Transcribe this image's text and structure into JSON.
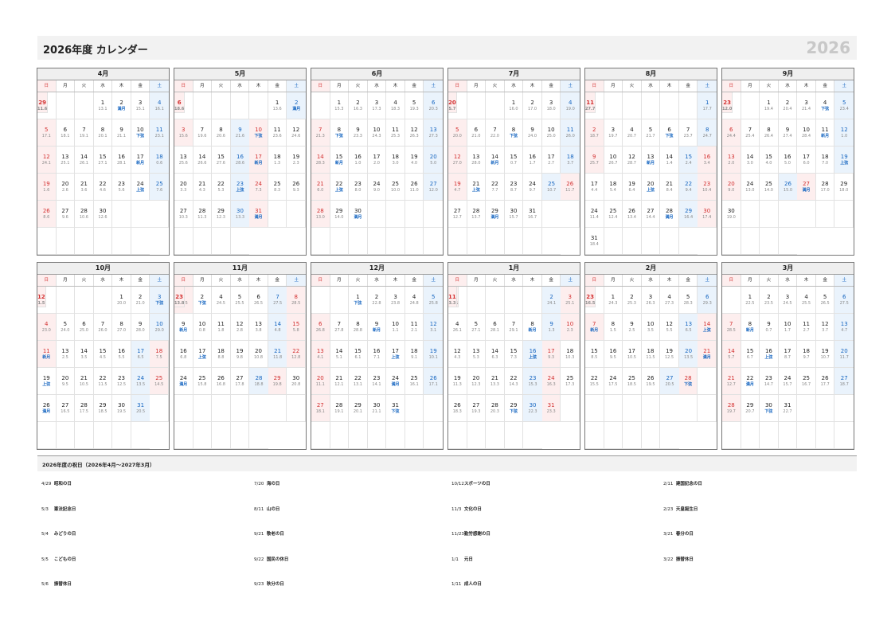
{
  "header": {
    "title": "2026年度 カレンダー",
    "year": "2026"
  },
  "weekdays": [
    "日",
    "月",
    "火",
    "水",
    "木",
    "金",
    "土"
  ],
  "months": [
    {
      "title": "4月",
      "offset": 3,
      "days": [
        {
          "a": "13.1"
        },
        {
          "a": "満月",
          "m": 1
        },
        {
          "a": "15.1"
        },
        {
          "a": "16.1"
        },
        {
          "a": "17.1"
        },
        {
          "a": "18.1"
        },
        {
          "a": "19.1"
        },
        {
          "a": "20.1"
        },
        {
          "a": "21.1"
        },
        {
          "a": "下弦",
          "m": 1
        },
        {
          "a": "23.1"
        },
        {
          "a": "24.1"
        },
        {
          "a": "25.1"
        },
        {
          "a": "26.1"
        },
        {
          "a": "27.1"
        },
        {
          "a": "28.1"
        },
        {
          "a": "新月",
          "m": 1
        },
        {
          "a": "0.6"
        },
        {
          "a": "1.6"
        },
        {
          "a": "2.6"
        },
        {
          "a": "3.6"
        },
        {
          "a": "4.6"
        },
        {
          "a": "5.6"
        },
        {
          "a": "上弦",
          "m": 1
        },
        {
          "a": "7.6"
        },
        {
          "a": "8.6"
        },
        {
          "a": "9.6"
        },
        {
          "a": "10.6"
        },
        {
          "a": "11.6",
          "h": 1
        },
        {
          "a": "12.6"
        }
      ]
    },
    {
      "title": "5月",
      "offset": 5,
      "days": [
        {
          "a": "13.6"
        },
        {
          "a": "満月",
          "m": 1
        },
        {
          "a": "15.6",
          "h": 1
        },
        {
          "a": "16.6",
          "h": 1
        },
        {
          "a": "17.6",
          "h": 1
        },
        {
          "a": "18.6",
          "h": 1
        },
        {
          "a": "19.6"
        },
        {
          "a": "20.6"
        },
        {
          "a": "21.6"
        },
        {
          "a": "下弦",
          "m": 1
        },
        {
          "a": "23.6"
        },
        {
          "a": "24.6"
        },
        {
          "a": "25.6"
        },
        {
          "a": "26.6"
        },
        {
          "a": "27.6"
        },
        {
          "a": "28.6"
        },
        {
          "a": "新月",
          "m": 1
        },
        {
          "a": "1.3"
        },
        {
          "a": "2.3"
        },
        {
          "a": "3.3"
        },
        {
          "a": "4.3"
        },
        {
          "a": "5.3"
        },
        {
          "a": "上弦",
          "m": 1
        },
        {
          "a": "7.3"
        },
        {
          "a": "8.3"
        },
        {
          "a": "9.3"
        },
        {
          "a": "10.3"
        },
        {
          "a": "11.3"
        },
        {
          "a": "12.3"
        },
        {
          "a": "13.3"
        },
        {
          "a": "満月",
          "m": 1
        }
      ]
    },
    {
      "title": "6月",
      "offset": 1,
      "days": [
        {
          "a": "15.3"
        },
        {
          "a": "16.3"
        },
        {
          "a": "17.3"
        },
        {
          "a": "18.3"
        },
        {
          "a": "19.3"
        },
        {
          "a": "20.3"
        },
        {
          "a": "21.3"
        },
        {
          "a": "下弦",
          "m": 1
        },
        {
          "a": "23.3"
        },
        {
          "a": "24.3"
        },
        {
          "a": "25.3"
        },
        {
          "a": "26.3"
        },
        {
          "a": "27.3"
        },
        {
          "a": "28.3"
        },
        {
          "a": "新月",
          "m": 1
        },
        {
          "a": "1.0"
        },
        {
          "a": "2.0"
        },
        {
          "a": "3.0"
        },
        {
          "a": "4.0"
        },
        {
          "a": "5.0"
        },
        {
          "a": "6.0"
        },
        {
          "a": "上弦",
          "m": 1
        },
        {
          "a": "8.0"
        },
        {
          "a": "9.0"
        },
        {
          "a": "10.0"
        },
        {
          "a": "11.0"
        },
        {
          "a": "12.0"
        },
        {
          "a": "13.0"
        },
        {
          "a": "14.0"
        },
        {
          "a": "満月",
          "m": 1
        }
      ]
    },
    {
      "title": "7月",
      "offset": 3,
      "days": [
        {
          "a": "16.0"
        },
        {
          "a": "17.0"
        },
        {
          "a": "18.0"
        },
        {
          "a": "19.0"
        },
        {
          "a": "20.0"
        },
        {
          "a": "21.0"
        },
        {
          "a": "22.0"
        },
        {
          "a": "下弦",
          "m": 1
        },
        {
          "a": "24.0"
        },
        {
          "a": "25.0"
        },
        {
          "a": "26.0"
        },
        {
          "a": "27.0"
        },
        {
          "a": "28.0"
        },
        {
          "a": "新月",
          "m": 1
        },
        {
          "a": "0.7"
        },
        {
          "a": "1.7"
        },
        {
          "a": "2.7"
        },
        {
          "a": "3.7"
        },
        {
          "a": "4.7"
        },
        {
          "a": "5.7",
          "h": 1
        },
        {
          "a": "上弦",
          "m": 1
        },
        {
          "a": "7.7"
        },
        {
          "a": "8.7"
        },
        {
          "a": "9.7"
        },
        {
          "a": "10.7"
        },
        {
          "a": "11.7"
        },
        {
          "a": "12.7"
        },
        {
          "a": "13.7"
        },
        {
          "a": "満月",
          "m": 1
        },
        {
          "a": "15.7"
        },
        {
          "a": "16.7"
        }
      ]
    },
    {
      "title": "8月",
      "offset": 6,
      "days": [
        {
          "a": "17.7"
        },
        {
          "a": "18.7"
        },
        {
          "a": "19.7"
        },
        {
          "a": "20.7"
        },
        {
          "a": "21.7"
        },
        {
          "a": "下弦",
          "m": 1
        },
        {
          "a": "23.7"
        },
        {
          "a": "24.7"
        },
        {
          "a": "25.7"
        },
        {
          "a": "26.7"
        },
        {
          "a": "27.7",
          "h": 1
        },
        {
          "a": "28.7"
        },
        {
          "a": "新月",
          "m": 1
        },
        {
          "a": "1.4"
        },
        {
          "a": "2.4"
        },
        {
          "a": "3.4"
        },
        {
          "a": "4.4"
        },
        {
          "a": "5.4"
        },
        {
          "a": "6.4"
        },
        {
          "a": "上弦",
          "m": 1
        },
        {
          "a": "8.4"
        },
        {
          "a": "9.4"
        },
        {
          "a": "10.4"
        },
        {
          "a": "11.4"
        },
        {
          "a": "12.4"
        },
        {
          "a": "13.4"
        },
        {
          "a": "14.4"
        },
        {
          "a": "満月",
          "m": 1
        },
        {
          "a": "16.4"
        },
        {
          "a": "17.4"
        },
        {
          "a": "18.4"
        }
      ]
    },
    {
      "title": "9月",
      "offset": 2,
      "days": [
        {
          "a": "19.4"
        },
        {
          "a": "20.4"
        },
        {
          "a": "21.4"
        },
        {
          "a": "下弦",
          "m": 1
        },
        {
          "a": "23.4"
        },
        {
          "a": "24.4"
        },
        {
          "a": "25.4"
        },
        {
          "a": "26.4"
        },
        {
          "a": "27.4"
        },
        {
          "a": "28.4"
        },
        {
          "a": "新月",
          "m": 1
        },
        {
          "a": "1.0"
        },
        {
          "a": "2.0"
        },
        {
          "a": "3.0"
        },
        {
          "a": "4.0"
        },
        {
          "a": "5.0"
        },
        {
          "a": "6.0"
        },
        {
          "a": "7.0"
        },
        {
          "a": "上弦",
          "m": 1
        },
        {
          "a": "9.0"
        },
        {
          "a": "10.0",
          "h": 1
        },
        {
          "a": "11.0",
          "h": 1
        },
        {
          "a": "12.0",
          "h": 1
        },
        {
          "a": "13.0"
        },
        {
          "a": "14.0"
        },
        {
          "a": "15.0"
        },
        {
          "a": "満月",
          "m": 1
        },
        {
          "a": "17.0"
        },
        {
          "a": "18.0"
        },
        {
          "a": "19.0"
        }
      ]
    },
    {
      "title": "10月",
      "offset": 4,
      "days": [
        {
          "a": "20.0"
        },
        {
          "a": "21.0"
        },
        {
          "a": "下弦",
          "m": 1
        },
        {
          "a": "23.0"
        },
        {
          "a": "24.0"
        },
        {
          "a": "25.0"
        },
        {
          "a": "26.0"
        },
        {
          "a": "27.0"
        },
        {
          "a": "28.0"
        },
        {
          "a": "29.0"
        },
        {
          "a": "新月",
          "m": 1
        },
        {
          "a": "1.5",
          "h": 1
        },
        {
          "a": "2.5"
        },
        {
          "a": "3.5"
        },
        {
          "a": "4.5"
        },
        {
          "a": "5.5"
        },
        {
          "a": "6.5"
        },
        {
          "a": "7.5"
        },
        {
          "a": "上弦",
          "m": 1
        },
        {
          "a": "9.5"
        },
        {
          "a": "10.5"
        },
        {
          "a": "11.5"
        },
        {
          "a": "12.5"
        },
        {
          "a": "13.5"
        },
        {
          "a": "14.5"
        },
        {
          "a": "満月",
          "m": 1
        },
        {
          "a": "16.5"
        },
        {
          "a": "17.5"
        },
        {
          "a": "18.5"
        },
        {
          "a": "19.5"
        },
        {
          "a": "20.5"
        }
      ]
    },
    {
      "title": "11月",
      "offset": 0,
      "days": [
        {
          "a": "21.5"
        },
        {
          "a": "下弦",
          "m": 1
        },
        {
          "a": "23.5",
          "h": 1
        },
        {
          "a": "24.5"
        },
        {
          "a": "25.5"
        },
        {
          "a": "26.5"
        },
        {
          "a": "27.5"
        },
        {
          "a": "28.5"
        },
        {
          "a": "新月",
          "m": 1
        },
        {
          "a": "0.8"
        },
        {
          "a": "1.8"
        },
        {
          "a": "2.8"
        },
        {
          "a": "3.8"
        },
        {
          "a": "4.8"
        },
        {
          "a": "5.8"
        },
        {
          "a": "6.8"
        },
        {
          "a": "上弦",
          "m": 1
        },
        {
          "a": "8.8"
        },
        {
          "a": "9.8"
        },
        {
          "a": "10.8"
        },
        {
          "a": "11.8"
        },
        {
          "a": "12.8"
        },
        {
          "a": "13.8",
          "h": 1
        },
        {
          "a": "満月",
          "m": 1
        },
        {
          "a": "15.8"
        },
        {
          "a": "16.8"
        },
        {
          "a": "17.8"
        },
        {
          "a": "18.8"
        },
        {
          "a": "19.8"
        },
        {
          "a": "20.8"
        }
      ]
    },
    {
      "title": "12月",
      "offset": 2,
      "days": [
        {
          "a": "下弦",
          "m": 1
        },
        {
          "a": "22.8"
        },
        {
          "a": "23.8"
        },
        {
          "a": "24.8"
        },
        {
          "a": "25.8"
        },
        {
          "a": "26.8"
        },
        {
          "a": "27.8"
        },
        {
          "a": "28.8"
        },
        {
          "a": "新月",
          "m": 1
        },
        {
          "a": "1.1"
        },
        {
          "a": "2.1"
        },
        {
          "a": "3.1"
        },
        {
          "a": "4.1"
        },
        {
          "a": "5.1"
        },
        {
          "a": "6.1"
        },
        {
          "a": "7.1"
        },
        {
          "a": "上弦",
          "m": 1
        },
        {
          "a": "9.1"
        },
        {
          "a": "10.1"
        },
        {
          "a": "11.1"
        },
        {
          "a": "12.1"
        },
        {
          "a": "13.1"
        },
        {
          "a": "14.1"
        },
        {
          "a": "満月",
          "m": 1
        },
        {
          "a": "16.1"
        },
        {
          "a": "17.1"
        },
        {
          "a": "18.1"
        },
        {
          "a": "19.1"
        },
        {
          "a": "20.1"
        },
        {
          "a": "21.1"
        },
        {
          "a": "下弦",
          "m": 1
        }
      ]
    },
    {
      "title": "1月",
      "offset": 5,
      "days": [
        {
          "a": "23.1",
          "h": 1
        },
        {
          "a": "24.1"
        },
        {
          "a": "25.1"
        },
        {
          "a": "26.1"
        },
        {
          "a": "27.1"
        },
        {
          "a": "28.1"
        },
        {
          "a": "29.1"
        },
        {
          "a": "新月",
          "m": 1
        },
        {
          "a": "1.3"
        },
        {
          "a": "2.3"
        },
        {
          "a": "3.3",
          "h": 1
        },
        {
          "a": "4.3"
        },
        {
          "a": "5.3"
        },
        {
          "a": "6.3"
        },
        {
          "a": "7.3"
        },
        {
          "a": "上弦",
          "m": 1
        },
        {
          "a": "9.3"
        },
        {
          "a": "10.3"
        },
        {
          "a": "11.3"
        },
        {
          "a": "12.3"
        },
        {
          "a": "13.3"
        },
        {
          "a": "14.3"
        },
        {
          "a": "15.3"
        },
        {
          "a": "16.3"
        },
        {
          "a": "17.3"
        },
        {
          "a": "18.3"
        },
        {
          "a": "19.3"
        },
        {
          "a": "20.3"
        },
        {
          "a": "下弦",
          "m": 1
        },
        {
          "a": "22.3"
        },
        {
          "a": "23.3"
        }
      ]
    },
    {
      "title": "2月",
      "offset": 1,
      "days": [
        {
          "a": "24.3"
        },
        {
          "a": "25.3"
        },
        {
          "a": "26.3"
        },
        {
          "a": "27.3"
        },
        {
          "a": "28.3"
        },
        {
          "a": "29.3"
        },
        {
          "a": "新月",
          "m": 1
        },
        {
          "a": "1.5"
        },
        {
          "a": "2.5"
        },
        {
          "a": "3.5"
        },
        {
          "a": "4.5",
          "h": 1
        },
        {
          "a": "5.5"
        },
        {
          "a": "6.5"
        },
        {
          "a": "上弦",
          "m": 1
        },
        {
          "a": "8.5"
        },
        {
          "a": "9.5"
        },
        {
          "a": "10.5"
        },
        {
          "a": "11.5"
        },
        {
          "a": "12.5"
        },
        {
          "a": "13.5"
        },
        {
          "a": "満月",
          "m": 1
        },
        {
          "a": "15.5"
        },
        {
          "a": "16.5",
          "h": 1
        },
        {
          "a": "17.5"
        },
        {
          "a": "18.5"
        },
        {
          "a": "19.5"
        },
        {
          "a": "20.5"
        },
        {
          "a": "下弦",
          "m": 1
        }
      ]
    },
    {
      "title": "3月",
      "offset": 1,
      "days": [
        {
          "a": "22.5"
        },
        {
          "a": "23.5"
        },
        {
          "a": "24.5"
        },
        {
          "a": "25.5"
        },
        {
          "a": "26.5"
        },
        {
          "a": "27.5"
        },
        {
          "a": "28.5"
        },
        {
          "a": "新月",
          "m": 1
        },
        {
          "a": "0.7"
        },
        {
          "a": "1.7"
        },
        {
          "a": "2.7"
        },
        {
          "a": "3.7"
        },
        {
          "a": "4.7"
        },
        {
          "a": "5.7"
        },
        {
          "a": "6.7"
        },
        {
          "a": "上弦",
          "m": 1
        },
        {
          "a": "8.7"
        },
        {
          "a": "9.7"
        },
        {
          "a": "10.7"
        },
        {
          "a": "11.7"
        },
        {
          "a": "12.7"
        },
        {
          "a": "満月",
          "m": 1
        },
        {
          "a": "14.7"
        },
        {
          "a": "15.7"
        },
        {
          "a": "16.7"
        },
        {
          "a": "17.7"
        },
        {
          "a": "18.7"
        },
        {
          "a": "19.7"
        },
        {
          "a": "20.7"
        },
        {
          "a": "下弦",
          "m": 1
        },
        {
          "a": "22.7"
        }
      ]
    }
  ],
  "holidays": {
    "title": "2026年度の祝日（2026年4月～2027年3月）",
    "columns": [
      [
        {
          "date": "4/29",
          "name": "昭和の日"
        },
        {
          "date": "5/3",
          "name": "憲法記念日"
        },
        {
          "date": "5/4",
          "name": "みどりの日"
        },
        {
          "date": "5/5",
          "name": "こどもの日"
        },
        {
          "date": "5/6",
          "name": "振替休日"
        }
      ],
      [
        {
          "date": "7/20",
          "name": "海の日"
        },
        {
          "date": "8/11",
          "name": "山の日"
        },
        {
          "date": "9/21",
          "name": "敬老の日"
        },
        {
          "date": "9/22",
          "name": "国民の休日"
        },
        {
          "date": "9/23",
          "name": "秋分の日"
        }
      ],
      [
        {
          "date": "10/12",
          "name": "スポーツの日"
        },
        {
          "date": "11/3",
          "name": "文化の日"
        },
        {
          "date": "11/23",
          "name": "勤労感謝の日"
        },
        {
          "date": "1/1",
          "name": "元日"
        },
        {
          "date": "1/11",
          "name": "成人の日"
        }
      ],
      [
        {
          "date": "2/11",
          "name": "建国記念の日"
        },
        {
          "date": "2/23",
          "name": "天皇誕生日"
        },
        {
          "date": "3/21",
          "name": "春分の日"
        },
        {
          "date": "3/22",
          "name": "振替休日"
        }
      ]
    ]
  }
}
